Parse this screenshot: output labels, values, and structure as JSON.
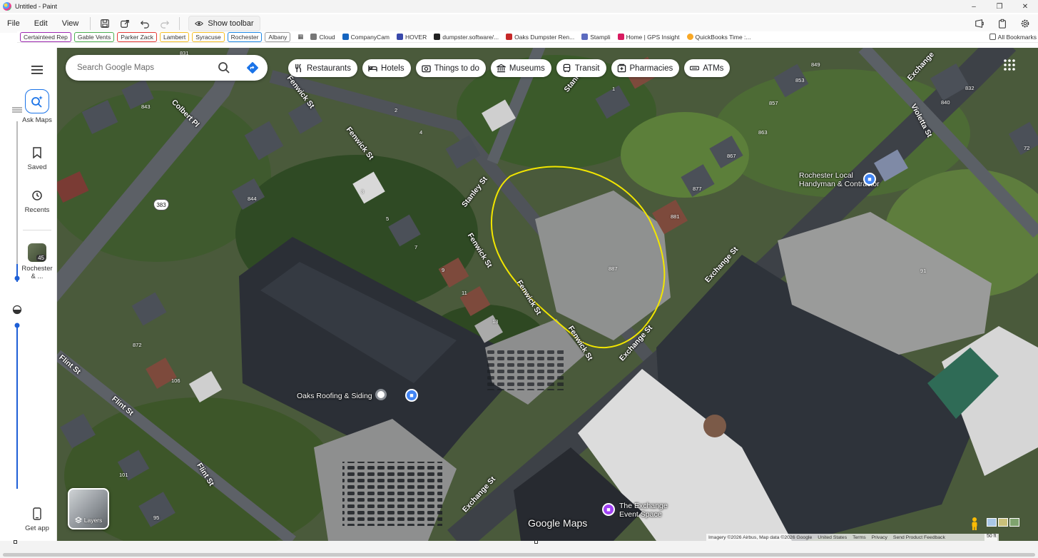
{
  "window": {
    "title": "Untitled - Paint"
  },
  "menu": {
    "items": [
      "File",
      "Edit",
      "View"
    ],
    "show_toolbar_label": "Show toolbar",
    "icons": [
      "save-icon",
      "share-icon",
      "undo-icon",
      "redo-icon"
    ]
  },
  "bookmarks": {
    "chips": [
      {
        "label": "Certainteed Rep",
        "color": "#9c27b0"
      },
      {
        "label": "Gable Vents",
        "color": "#4caf50"
      },
      {
        "label": "Parker Zack",
        "color": "#e53935"
      },
      {
        "label": "Lambert",
        "color": "#f6bf26"
      },
      {
        "label": "Syracuse",
        "color": "#f6bf26"
      },
      {
        "label": "Rochester",
        "color": "#1e88e5"
      },
      {
        "label": "Albany",
        "color": "#9e9e9e"
      }
    ],
    "links": [
      {
        "label": "Cloud",
        "color": "#555555"
      },
      {
        "label": "CompanyCam",
        "color": "#1565c0"
      },
      {
        "label": "HOVER",
        "color": "#3949ab"
      },
      {
        "label": "dumpster.software/...",
        "color": "#212121"
      },
      {
        "label": "Oaks Dumpster Ren...",
        "color": "#c62828"
      },
      {
        "label": "Stampli",
        "color": "#5c6bc0"
      },
      {
        "label": "Home | GPS Insight",
        "color": "#d81b60"
      },
      {
        "label": "QuickBooks Time :...",
        "color": "#f9a825"
      }
    ],
    "all_bookmarks": "All Bookmarks"
  },
  "rail": {
    "ask_maps": "Ask Maps",
    "saved": "Saved",
    "recents": "Recents",
    "recent_place": "Rochester & ...",
    "recent_place_count": "45",
    "get_app": "Get app"
  },
  "search": {
    "placeholder": "Search Google Maps"
  },
  "categories": [
    {
      "label": "Restaurants",
      "icon": "restaurant-icon"
    },
    {
      "label": "Hotels",
      "icon": "hotel-icon"
    },
    {
      "label": "Things to do",
      "icon": "camera-icon"
    },
    {
      "label": "Museums",
      "icon": "museum-icon"
    },
    {
      "label": "Transit",
      "icon": "transit-icon"
    },
    {
      "label": "Pharmacies",
      "icon": "pharmacy-icon"
    },
    {
      "label": "ATMs",
      "icon": "atm-icon"
    }
  ],
  "map": {
    "streets": {
      "fenwick_1": "Fenwick St",
      "fenwick_2": "Fenwick St",
      "fenwick_3": "Fenwick St",
      "fenwick_4": "Fenwick St",
      "fenwick_5": "Fenwick St",
      "stanley_1": "Stanley St",
      "stanley_2": "Stanley",
      "colbert": "Colbert Pl",
      "exchange_1": "Exchange St",
      "exchange_2": "Exchange St",
      "exchange_3": "Exchange St",
      "exchange_4": "Exchange",
      "violetta": "Violetta St",
      "flint_1": "Flint St",
      "flint_2": "Flint St",
      "flint_3": "Flint St"
    },
    "route_shield": "383",
    "addresses": [
      "843",
      "831",
      "844",
      "872",
      "106",
      "101",
      "95",
      "2",
      "4",
      "3",
      "5",
      "7",
      "9",
      "11",
      "13",
      "1",
      "887",
      "881",
      "877",
      "867",
      "863",
      "857",
      "853",
      "849",
      "840",
      "832",
      "72",
      "91"
    ],
    "pois": {
      "oaks": "Oaks Roofing & Siding",
      "rochester_local": "Rochester Local Handyman & Contractor",
      "exchange_space": "The Exchange Event Space"
    },
    "layers_label": "Layers",
    "logo": "Google Maps",
    "attribution": [
      "Imagery ©2026 Airbus, Map data ©2026 Google",
      "United States",
      "Terms",
      "Privacy",
      "Send Product Feedback"
    ],
    "scale": "50 ft"
  },
  "colors": {
    "accent": "#1a73e8",
    "annotation": "#f2e600"
  }
}
